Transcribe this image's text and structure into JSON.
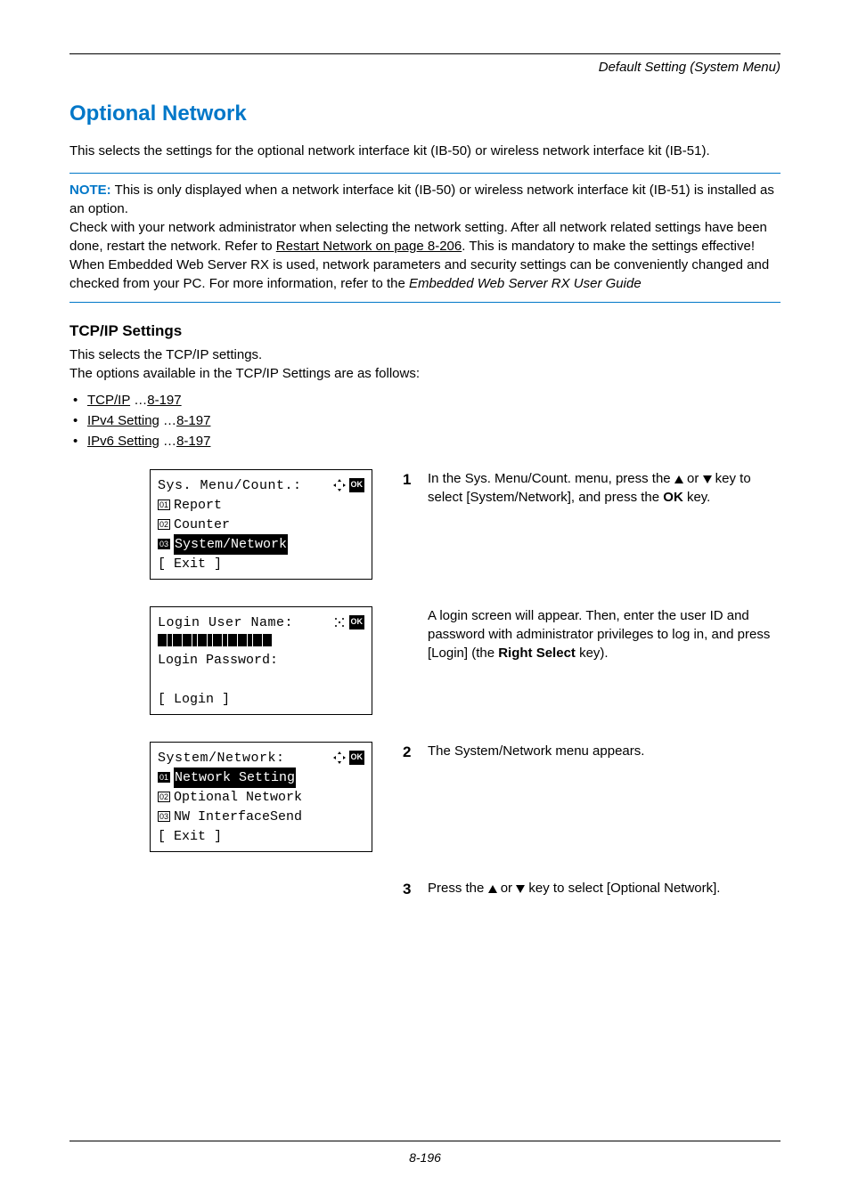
{
  "header": {
    "breadcrumb": "Default Setting (System Menu)"
  },
  "title": "Optional Network",
  "intro": "This selects the settings for the optional network interface kit (IB-50) or wireless network interface kit (IB-51).",
  "note": {
    "label": "NOTE:",
    "line1": " This is only displayed when a network interface kit (IB-50) or wireless network interface kit (IB-51) is installed as an option.",
    "line2a": "Check with your network administrator when selecting the network setting. After all network related settings have been done, restart the network. Refer to ",
    "link": "Restart Network on page 8-206",
    "line2b": ". This is mandatory to make the settings effective!",
    "line3a": "When Embedded Web Server RX is used, network parameters and security settings can be conveniently changed and checked from your PC. For more information, refer to the ",
    "ital": "Embedded Web Server RX User Guide"
  },
  "section": {
    "heading": "TCP/IP Settings",
    "line1": "This selects the TCP/IP settings.",
    "line2": "The options available in the TCP/IP Settings are as follows:",
    "opts": [
      {
        "label": "TCP/IP",
        "page": "8-197"
      },
      {
        "label": "IPv4 Setting",
        "page": "8-197"
      },
      {
        "label": "IPv6 Setting",
        "page": "8-197"
      }
    ]
  },
  "lcd1": {
    "title": "Sys. Menu/Count.:",
    "items": [
      {
        "num": "01",
        "label": "Report",
        "sel": false
      },
      {
        "num": "02",
        "label": "Counter",
        "sel": false
      },
      {
        "num": "03",
        "label": "System/Network",
        "sel": true
      }
    ],
    "soft": "[  Exit   ]"
  },
  "lcd2": {
    "title": "Login User Name:",
    "pwd_label": "Login Password:",
    "soft": "[  Login  ]"
  },
  "lcd3": {
    "title": "System/Network:",
    "items": [
      {
        "num": "01",
        "label": "Network Setting",
        "sel": true
      },
      {
        "num": "02",
        "label": "Optional Network",
        "sel": false
      },
      {
        "num": "03",
        "label": "NW InterfaceSend",
        "sel": false
      }
    ],
    "soft": "[  Exit   ]"
  },
  "steps": {
    "s1a": "In the Sys. Menu/Count. menu, press the ",
    "s1b": " or ",
    "s1c": " key to select [System/Network], and press the ",
    "s1d": "OK",
    "s1e": " key.",
    "s1f": "A login screen will appear. Then, enter the user ID and password with administrator privileges to log in, and press [Login] (the ",
    "s1g": "Right Select",
    "s1h": " key).",
    "s2": "The System/Network menu appears.",
    "s3a": "Press the ",
    "s3b": " or ",
    "s3c": " key to select [Optional Network]."
  },
  "footer": {
    "page": "8-196"
  }
}
